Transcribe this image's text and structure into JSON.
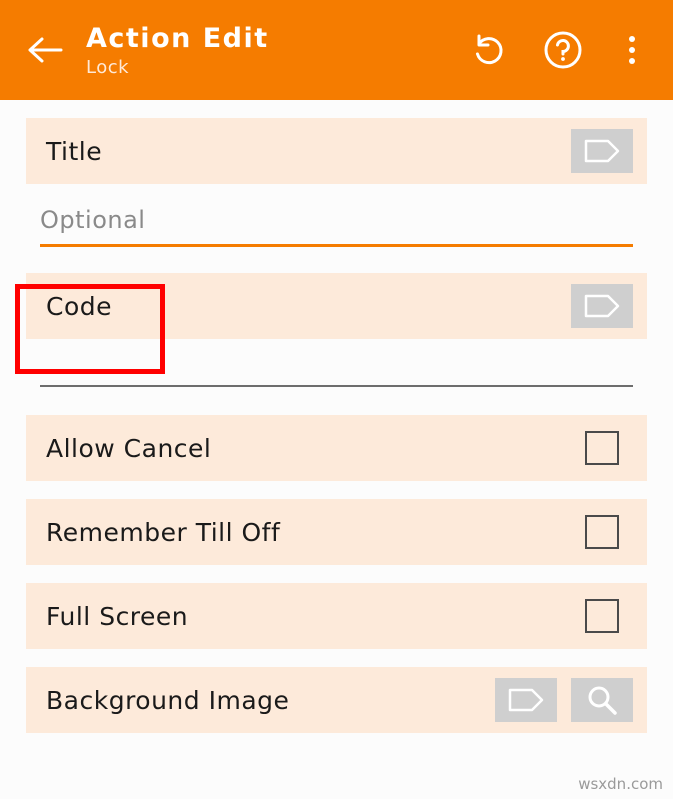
{
  "appbar": {
    "back_icon": "arrow-left-icon",
    "title": "Action Edit",
    "subtitle": "Lock",
    "undo_icon": "undo-icon",
    "help_icon": "help-circle-icon",
    "overflow_icon": "more-vertical-icon",
    "background_color": "#f57c00",
    "title_color": "#ffffff"
  },
  "form": {
    "title_row": {
      "label": "Title",
      "tag_button_icon": "tag-icon"
    },
    "title_input": {
      "value": "",
      "placeholder": "Optional",
      "underline_color": "#f57c00"
    },
    "code_row": {
      "label": "Code",
      "tag_button_icon": "tag-icon",
      "highlight_color": "#ff0000"
    },
    "checkbox_rows": [
      {
        "label": "Allow Cancel",
        "checked": false
      },
      {
        "label": "Remember Till Off",
        "checked": false
      },
      {
        "label": "Full Screen",
        "checked": false
      }
    ],
    "background_image_row": {
      "label": "Background Image",
      "tag_button_icon": "tag-icon",
      "search_button_icon": "search-icon"
    }
  },
  "watermark": "wsxdn.com"
}
